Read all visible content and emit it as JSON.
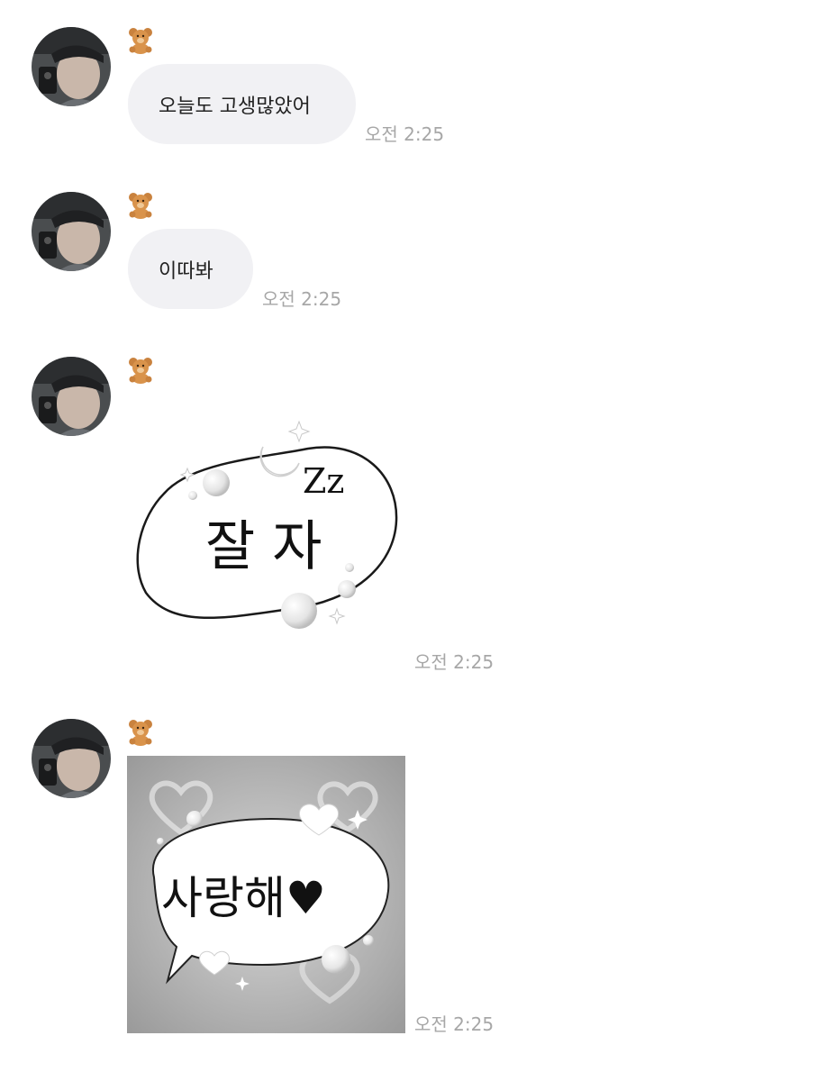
{
  "colors": {
    "bubble_background": "#f1f1f4",
    "timestamp_text": "#a7a7a7",
    "message_text": "#222222"
  },
  "icons": {
    "avatar": "profile-photo-icon",
    "sender_badge": "teddy-bear-icon"
  },
  "messages": [
    {
      "type": "text",
      "text": "오늘도 고생많았어",
      "time": "오전 2:25"
    },
    {
      "type": "text",
      "text": "이따봐",
      "time": "오전 2:25"
    },
    {
      "type": "sticker",
      "sticker_text": "잘 자",
      "sticker_extra": "Zz",
      "time": "오전 2:25"
    },
    {
      "type": "image",
      "image_text": "사랑해♥",
      "time": "오전 2:25"
    }
  ]
}
